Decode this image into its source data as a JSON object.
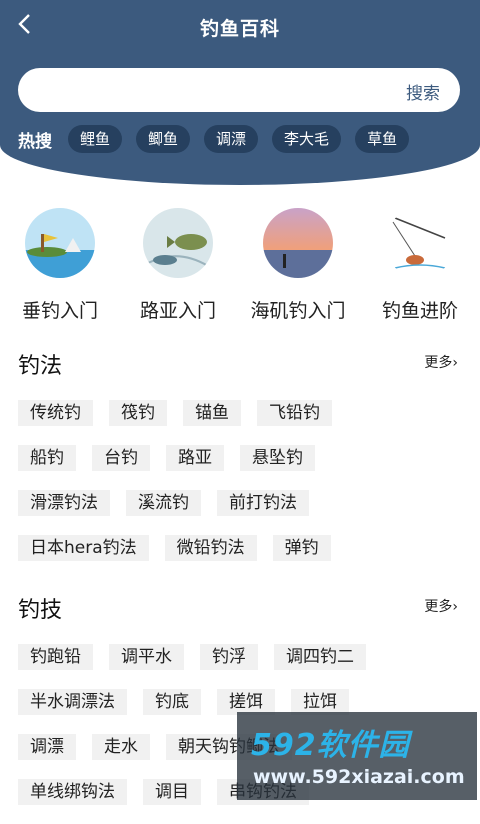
{
  "header": {
    "title": "钓鱼百科",
    "back_icon": "back-chevron-icon"
  },
  "search": {
    "value": "",
    "placeholder": "",
    "button_label": "搜索"
  },
  "hot": {
    "label": "热搜",
    "tags": [
      "鲤鱼",
      "鲫鱼",
      "调漂",
      "李大毛",
      "草鱼"
    ]
  },
  "categories": [
    {
      "label": "垂钓入门",
      "icon": "lake-scene-icon"
    },
    {
      "label": "路亚入门",
      "icon": "lure-fish-icon"
    },
    {
      "label": "海矶钓入门",
      "icon": "sunset-sea-icon"
    },
    {
      "label": "钓鱼进阶",
      "icon": "fishing-sketch-icon"
    }
  ],
  "sections": [
    {
      "title": "钓法",
      "more": "更多",
      "rows": [
        [
          "传统钓",
          "筏钓",
          "锚鱼",
          "飞铅钓"
        ],
        [
          "船钓",
          "台钓",
          "路亚",
          "悬坠钓"
        ],
        [
          "滑漂钓法",
          "溪流钓",
          "前打钓法"
        ],
        [
          "日本hera钓法",
          "微铅钓法",
          "弹钓"
        ]
      ]
    },
    {
      "title": "钓技",
      "more": "更多",
      "rows": [
        [
          "钓跑铅",
          "调平水",
          "钓浮",
          "调四钓二"
        ],
        [
          "半水调漂法",
          "钓底",
          "搓饵",
          "拉饵"
        ],
        [
          "调漂",
          "走水",
          "朝天钩钓鲫法"
        ],
        [
          "单线绑钩法",
          "调目",
          "串钩钓法"
        ]
      ]
    }
  ],
  "watermark": {
    "title": "592软件园",
    "url": "www.592xiazai.com"
  },
  "colors": {
    "header": "#3c5a7e",
    "hot_tag": "#26405f",
    "tag_bg": "#f1f1f1"
  }
}
